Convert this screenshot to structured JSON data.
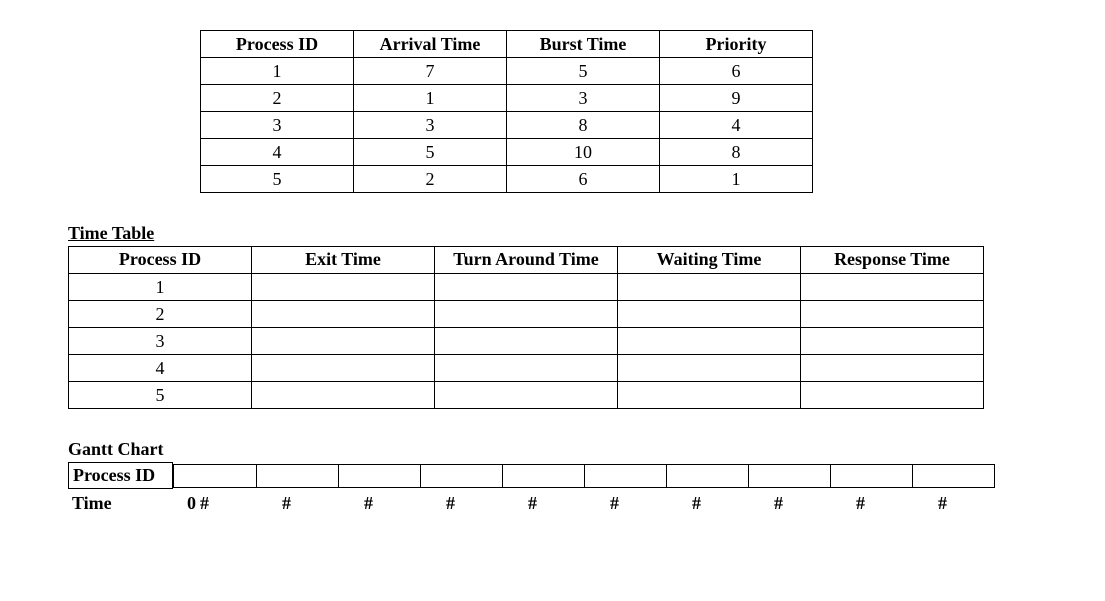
{
  "input_table": {
    "headers": [
      "Process ID",
      "Arrival Time",
      "Burst Time",
      "Priority"
    ],
    "rows": [
      [
        "1",
        "7",
        "5",
        "6"
      ],
      [
        "2",
        "1",
        "3",
        "9"
      ],
      [
        "3",
        "3",
        "8",
        "4"
      ],
      [
        "4",
        "5",
        "10",
        "8"
      ],
      [
        "5",
        "2",
        "6",
        "1"
      ]
    ]
  },
  "time_table": {
    "title": "Time Table",
    "headers": [
      "Process ID",
      "Exit Time",
      "Turn Around Time",
      "Waiting Time",
      "Response Time"
    ],
    "rows": [
      [
        "1",
        "",
        "",
        "",
        ""
      ],
      [
        "2",
        "",
        "",
        "",
        ""
      ],
      [
        "3",
        "",
        "",
        "",
        ""
      ],
      [
        "4",
        "",
        "",
        "",
        ""
      ],
      [
        "5",
        "",
        "",
        "",
        ""
      ]
    ]
  },
  "gantt": {
    "title": "Gantt Chart",
    "pid_label": "Process ID",
    "time_label": "Time",
    "first_time": "0",
    "times": [
      "#",
      "#",
      "#",
      "#",
      "#",
      "#",
      "#",
      "#",
      "#",
      "#"
    ],
    "slot_count": 10
  }
}
